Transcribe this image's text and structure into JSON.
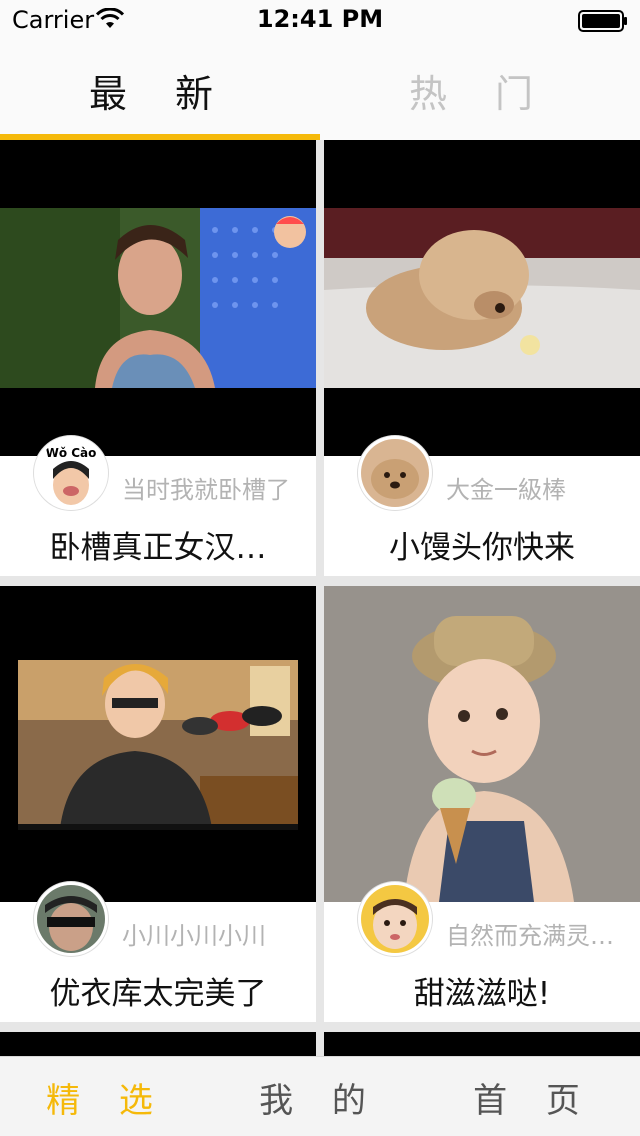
{
  "status_bar": {
    "carrier": "Carrier",
    "time": "12:41 PM"
  },
  "top_tabs": [
    {
      "label": "最 新",
      "active": true
    },
    {
      "label": "热 门",
      "active": false
    }
  ],
  "colors": {
    "accent": "#f5b90a",
    "inactive_tab": "#c4c4c4",
    "author_text": "#b3b3b3"
  },
  "cards": [
    {
      "author": "当时我就卧槽了",
      "title": "卧槽真正女汉…",
      "avatar_text": "Wǒ Cào"
    },
    {
      "author": "大金一級棒",
      "title": "小馒头你快来",
      "avatar_text": ""
    },
    {
      "author": "小川小川小川",
      "title": "优衣库太完美了",
      "avatar_text": ""
    },
    {
      "author": "自然而充满灵…",
      "title": "甜滋滋哒!",
      "avatar_text": ""
    }
  ],
  "bottom_tabs": [
    {
      "label": "精 选",
      "active": true
    },
    {
      "label": "我 的",
      "active": false
    },
    {
      "label": "首 页",
      "active": false
    }
  ]
}
